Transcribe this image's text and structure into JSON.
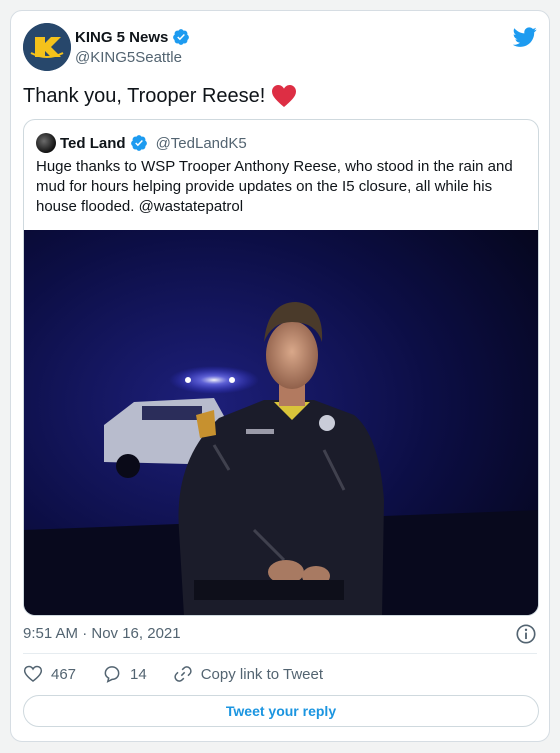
{
  "tweet": {
    "author_name": "KING 5 News",
    "author_handle": "@KING5Seattle",
    "text": "Thank you, Trooper Reese!",
    "timestamp": "9:51 AM · Nov 16, 2021"
  },
  "quoted": {
    "author_name": "Ted Land",
    "author_handle": "@TedLandK5",
    "text": "Huge thanks to WSP Trooper Anthony Reese, who stood in the rain and mud for hours helping provide updates on the I5 closure, all while his house flooded. @wastatepatrol"
  },
  "actions": {
    "likes": "467",
    "replies": "14",
    "copy_link_label": "Copy link to Tweet",
    "reply_button_label": "Tweet your reply"
  },
  "icons": {
    "brand": "twitter-logo-icon",
    "verified": "verified-badge-icon",
    "emoji": "red-heart-emoji",
    "like": "heart-outline-icon",
    "reply": "speech-bubble-icon",
    "link": "link-icon",
    "info": "info-icon"
  },
  "colors": {
    "twitter_blue": "#1d9bf0",
    "link_blue": "#1b95e0",
    "heart_red": "#dd2e44",
    "muted_text": "#536471"
  }
}
